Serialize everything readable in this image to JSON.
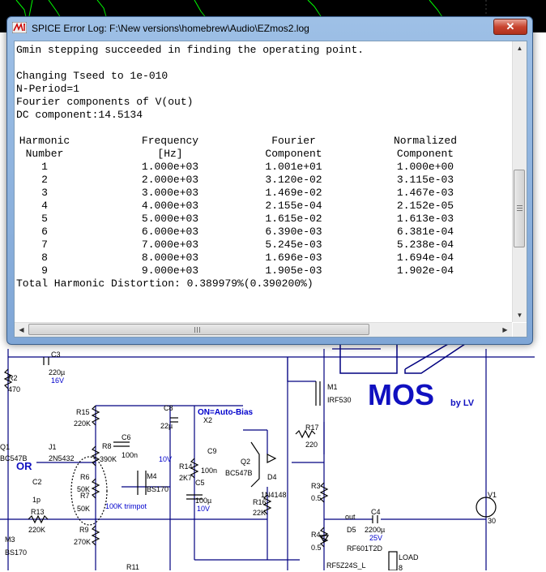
{
  "window": {
    "title": "SPICE Error Log: F:\\New versions\\homebrew\\Audio\\EZmos2.log",
    "close_glyph": "✕"
  },
  "log": {
    "lines": [
      "Gmin stepping succeeded in finding the operating point.",
      "",
      "Changing Tseed to 1e-010",
      "N-Period=1",
      "Fourier components of V(out)",
      "DC component:14.5134"
    ],
    "table": {
      "headers_row1": [
        "Harmonic",
        "Frequency",
        "Fourier",
        "Normalized"
      ],
      "headers_row2": [
        "Number",
        "[Hz]",
        "Component",
        "Component"
      ],
      "rows": [
        [
          "1",
          "1.000e+03",
          "1.001e+01",
          "1.000e+00"
        ],
        [
          "2",
          "2.000e+03",
          "3.120e-02",
          "3.115e-03"
        ],
        [
          "3",
          "3.000e+03",
          "1.469e-02",
          "1.467e-03"
        ],
        [
          "4",
          "4.000e+03",
          "2.155e-04",
          "2.152e-05"
        ],
        [
          "5",
          "5.000e+03",
          "1.615e-02",
          "1.613e-03"
        ],
        [
          "6",
          "6.000e+03",
          "6.390e-03",
          "6.381e-04"
        ],
        [
          "7",
          "7.000e+03",
          "5.245e-03",
          "5.238e-04"
        ],
        [
          "8",
          "8.000e+03",
          "1.696e-03",
          "1.694e-04"
        ],
        [
          "9",
          "9.000e+03",
          "1.905e-03",
          "1.902e-04"
        ]
      ]
    },
    "thd": "Total Harmonic Distortion: 0.389979%(0.390200%)"
  },
  "schematic": {
    "logo_text": "MOS",
    "logo_by": "by LV",
    "bias_label": "ON=Auto-Bias",
    "or_label": "OR",
    "trimpot_label": "100K trimpot",
    "out_label": "out",
    "load_label": "LOAD",
    "parts": {
      "c3": "C3",
      "c3v": "220µ",
      "c3r": "16V",
      "r2": "R2",
      "r2v": "470",
      "m1": "M1",
      "m1v": "IRF530",
      "r15": "R15",
      "r15v": "220K",
      "c8": "C8",
      "c8v": "22µ",
      "x2": "X2",
      "r8": "R8",
      "r8v": "390K",
      "c6": "C6",
      "c6v": "100n",
      "r17": "R17",
      "r17v": "220",
      "q1": "Q1",
      "q1v": "BC547B",
      "j1": "J1",
      "j1v": "2N5432",
      "c9": "C9",
      "c9v": "100n",
      "q2": "Q2",
      "q2v": "BC547B",
      "c2": "C2",
      "c2v": "1p",
      "r6": "R6",
      "r6v": "50K",
      "r7": "R7",
      "r7v": "50K",
      "m4": "M4",
      "m4v": "BS170",
      "r14": "R14",
      "r14v": "2K7",
      "tenv": "10V",
      "c5": "C5",
      "c5v": "100µ",
      "c5r": "10V",
      "d4": "D4",
      "d4v": "1N4148",
      "r3": "R3",
      "r3v": "0.5",
      "r13": "R13",
      "r13v": "220K",
      "r16": "R16",
      "r16v": "22K",
      "v1": "V1",
      "v1v": "30",
      "c4": "C4",
      "c4v": "2200µ",
      "c4r": "25V",
      "m3": "M3",
      "m3v": "BS170",
      "r9": "R9",
      "r9v": "270K",
      "r4": "R4",
      "r4v": "0.5",
      "d5": "D5",
      "d5v": "RF601T2D",
      "r11": "R11",
      "m2v": "RF5Z24S_L",
      "loadv": "8"
    }
  },
  "colors": {
    "wire": "#000080",
    "component": "#000000",
    "plot_bg": "#000000",
    "plot_trace": "#00ff00",
    "logo": "#1010c0"
  },
  "icons": {
    "app": "ltspice-icon",
    "close": "close-icon",
    "scroll_up": "scroll-up-icon",
    "scroll_down": "scroll-down-icon",
    "scroll_left": "scroll-left-icon",
    "scroll_right": "scroll-right-icon"
  }
}
